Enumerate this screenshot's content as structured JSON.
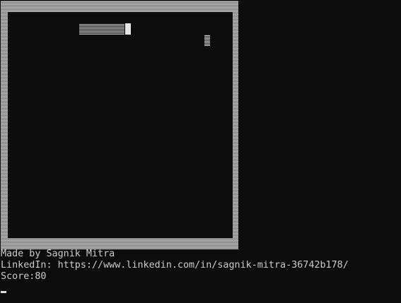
{
  "credits": {
    "made_by": "Made by Sagnik Mitra",
    "linkedin": "LinkedIn: https://www.linkedin.com/in/sagnik-mitra-36742b178/"
  },
  "score": {
    "label": "Score:80",
    "value": 80
  }
}
